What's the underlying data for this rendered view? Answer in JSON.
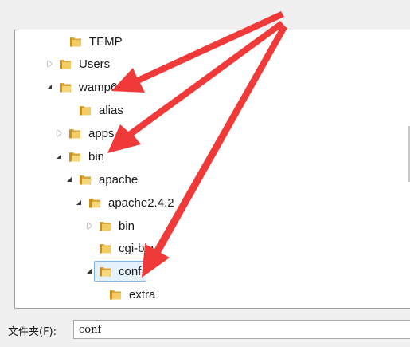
{
  "tree": {
    "items": [
      {
        "label": "TEMP",
        "state": "none",
        "depth": 0
      },
      {
        "label": "Users",
        "state": "collapsed",
        "depth": 0
      },
      {
        "label": "wamp64",
        "state": "expanded",
        "depth": 0
      },
      {
        "label": "alias",
        "state": "none",
        "depth": 1
      },
      {
        "label": "apps",
        "state": "collapsed",
        "depth": 1
      },
      {
        "label": "bin",
        "state": "expanded",
        "depth": 1
      },
      {
        "label": "apache",
        "state": "expanded",
        "depth": 2
      },
      {
        "label": "apache2.4.2",
        "state": "expanded",
        "depth": 3
      },
      {
        "label": "bin",
        "state": "collapsed",
        "depth": 4
      },
      {
        "label": "cgi-bin",
        "state": "none",
        "depth": 4
      },
      {
        "label": "conf",
        "state": "expanded",
        "depth": 4,
        "selected": true
      },
      {
        "label": "extra",
        "state": "none",
        "depth": 5
      }
    ]
  },
  "folder_field": {
    "label": "文件夹(F):",
    "value": "conf"
  },
  "colors": {
    "arrow": "#f03a3a",
    "selection_bg": "#e5f1fb",
    "selection_border": "#7eb4ea",
    "folder": "#e8b64a"
  }
}
